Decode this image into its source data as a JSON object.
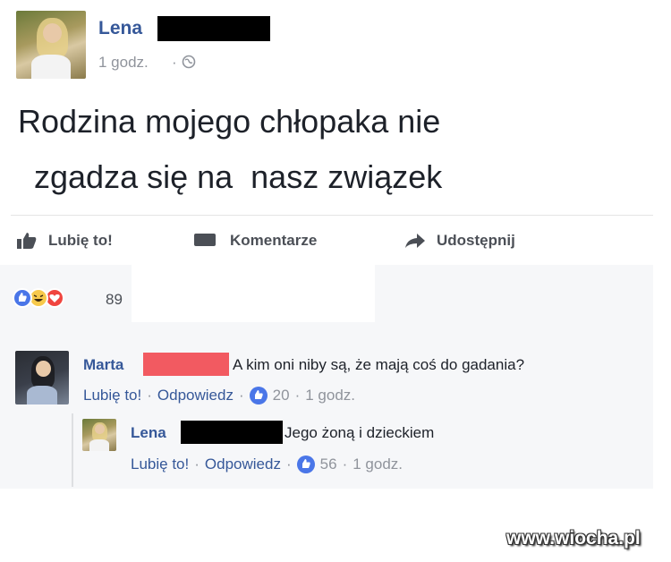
{
  "post": {
    "author": "Lena",
    "time": "1 godz.",
    "separator": "·",
    "text_line1": "Rodzina mojego chłopaka nie",
    "text_line2": "zgadza się na  nasz związek"
  },
  "actions": {
    "like": "Lubię to!",
    "comment": "Komentarze",
    "share": "Udostępnij"
  },
  "reactions": {
    "count": "89",
    "icons": [
      "like-icon",
      "haha-icon",
      "love-icon"
    ]
  },
  "comments": [
    {
      "author": "Marta",
      "text": "A kim oni niby są, że mają coś do gadania?",
      "like": "Lubię to!",
      "reply": "Odpowiedz",
      "likes": "20",
      "time": "1 godz.",
      "sep": "·"
    },
    {
      "author": "Lena",
      "text": "Jego żoną i dzieckiem",
      "like": "Lubię to!",
      "reply": "Odpowiedz",
      "likes": "56",
      "time": "1 godz.",
      "sep": "·"
    }
  ],
  "watermark": "www.wiocha.pl",
  "colors": {
    "link_blue": "#365899",
    "like_blue": "#4a76e8",
    "redact_red": "#f25a61",
    "meta_gray": "#90949c"
  }
}
